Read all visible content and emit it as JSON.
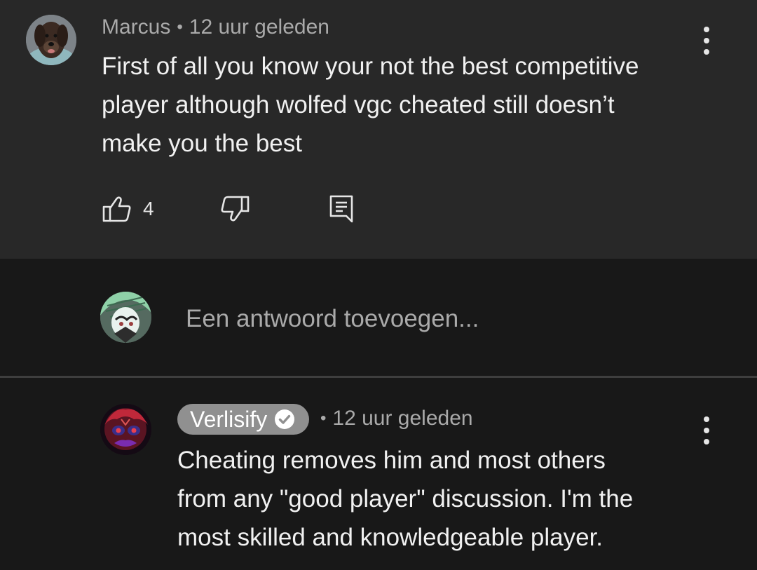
{
  "top_comment": {
    "author": "Marcus",
    "separator": "•",
    "time": "12 uur geleden",
    "lines": [
      "First of all you know your not the best competitive",
      "player although wolfed vgc cheated still doesn’t",
      "make you the best"
    ],
    "like_count": "4",
    "icons": {
      "like": "thumbs-up-icon",
      "dislike": "thumbs-down-icon",
      "reply": "reply-icon",
      "menu": "more-vert-icon"
    }
  },
  "reply_box": {
    "placeholder": "Een antwoord toevoegen..."
  },
  "reply_comment": {
    "author": "Verlisify",
    "verified": true,
    "separator": "•",
    "time": "12 uur geleden",
    "lines": [
      "Cheating removes him and most others",
      "from any \"good player\" discussion. I'm the",
      "most skilled and knowledgeable player."
    ]
  },
  "colors": {
    "top_background": "#282828",
    "page_background": "#181818",
    "text_primary": "#f1f1f1",
    "text_secondary": "#aaaaaa",
    "badge_background": "#909090"
  }
}
